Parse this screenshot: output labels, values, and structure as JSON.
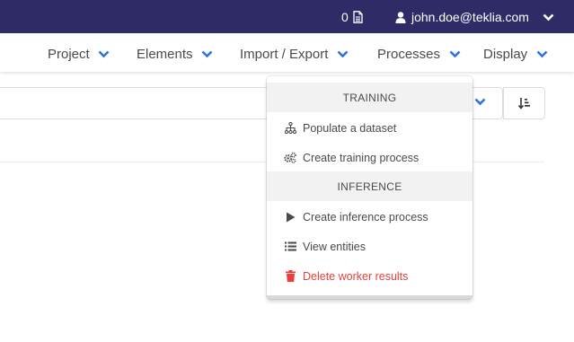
{
  "topbar": {
    "selection_count": "0",
    "user_email": "john.doe@teklia.com"
  },
  "menu": {
    "items": [
      {
        "label": "Project"
      },
      {
        "label": "Elements"
      },
      {
        "label": "Import / Export"
      },
      {
        "label": "Processes"
      },
      {
        "label": "Display"
      }
    ]
  },
  "dropdown": {
    "training_header": "TRAINING",
    "populate_dataset": "Populate a dataset",
    "create_training_process": "Create training process",
    "inference_header": "INFERENCE",
    "create_inference_process": "Create inference process",
    "view_entities": "View entities",
    "delete_worker_results": "Delete worker results"
  },
  "colors": {
    "topbar_bg": "#2f2b66",
    "accent_chevron": "#3273dc",
    "danger": "#e8403a"
  },
  "icons": {
    "counter": "file-text-icon",
    "user": "user-icon",
    "populate": "sitemap-icon",
    "training": "cogs-icon",
    "inference": "play-icon",
    "entities": "list-icon",
    "delete": "trash-icon",
    "sort": "sort-amount-icon"
  }
}
